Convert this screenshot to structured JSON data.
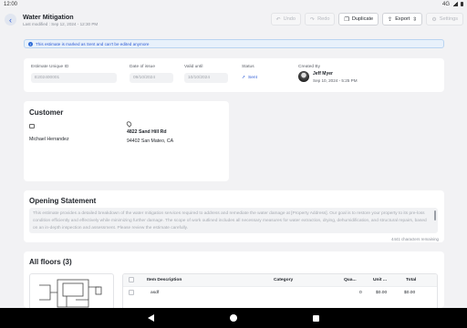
{
  "status_bar": {
    "time": "12:00",
    "network": "4G"
  },
  "header": {
    "title": "Water Mitigation",
    "subtitle": "Last modified : Sep 12, 2024 - 12:30 PM",
    "actions": {
      "undo": "Undo",
      "redo": "Redo",
      "duplicate": "Duplicate",
      "export": "Export",
      "settings": "Settings"
    }
  },
  "banner": {
    "text": "This estimate is marked as Sent and can't be edited anymore"
  },
  "meta": {
    "estimate_id": {
      "label": "Estimate Unique ID",
      "value": "E202400001"
    },
    "date_of_issue": {
      "label": "Date of issue",
      "value": "09/10/2024"
    },
    "valid_until": {
      "label": "Valid until",
      "value": "10/10/2024"
    },
    "status": {
      "label": "Status",
      "value": "Sent"
    },
    "created_by": {
      "label": "Created By",
      "name": "Jeff Myer",
      "date": "Sep 10, 2024 - 5:25 PM"
    }
  },
  "customer": {
    "heading": "Customer",
    "name": "Michael Herrandez",
    "address_line1": "4822 Sand Hill Rd",
    "address_line2": "94402 San Mateo, CA"
  },
  "opening_statement": {
    "heading": "Opening Statement",
    "text": "This estimate provides a detailed breakdown of the water mitigation services required to address and remediate the water damage at [Property Address]. Our goal is to restore your property to its pre-loss condition efficiently and effectively while minimizing further damage. The scope of work outlined includes all necessary measures for water extraction, drying, dehumidification, and structural repairs, based on an in-depth inspection and assessment. Please review the estimate carefully.",
    "remaining": "4441 characters remaining"
  },
  "floors": {
    "heading": "All floors (3)",
    "columns": [
      "Item Description",
      "Category",
      "Qua...",
      "Unit ...",
      "Total"
    ],
    "rows": [
      {
        "description": "asdf",
        "category": "",
        "quantity": "0",
        "unit": "$0.00",
        "total": "$0.00"
      }
    ]
  },
  "colors": {
    "accent": "#2d5bd6",
    "banner_bg": "#e8f1fb",
    "background": "#f2f2f4"
  },
  "icons": {
    "back": "chevron-left-icon",
    "undo": "undo-icon",
    "redo": "redo-icon",
    "duplicate": "duplicate-icon",
    "export": "export-icon",
    "settings": "gear-icon",
    "info": "info-icon",
    "status": "send-icon",
    "customer": "id-card-icon",
    "address": "map-pin-icon"
  }
}
